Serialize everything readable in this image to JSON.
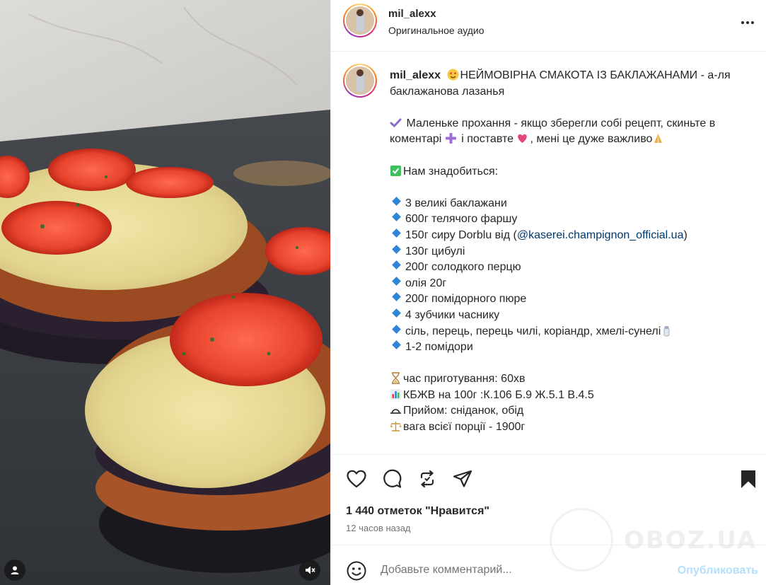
{
  "header": {
    "username": "mil_alexx",
    "audio": "Оригинальное аудио",
    "more_icon": "more-horizontal-icon"
  },
  "caption": {
    "username": "mil_alexx",
    "title": "НЕЙМОВІРНА СМАКОТА ІЗ БАКЛАЖАНАМИ - а-ля баклажанова лазанья",
    "request_part1": "Маленьке прохання - якщо зберегли собі рецепт, скиньте в коментарі",
    "request_part2": "і поставте",
    "request_part3": ", мені це дуже важливо",
    "need": "Нам знадобиться:",
    "ingredients": [
      "3 великі баклажани",
      "600г телячого фаршу",
      "150г сиру Dorblu від (",
      "130г цибулі",
      "200г солодкого перцю",
      "олія 20г",
      "200г помідорного пюре",
      "4 зубчики часнику",
      "сіль, перець, перець чилі, коріандр, хмелі-сунелі",
      "1-2 помідори"
    ],
    "mention": "@kaserei.champignon_official.ua",
    "mention_close": ")",
    "time": "час приготування: 60хв",
    "kbzhu": "КБЖВ на 100г :К.106 Б.9 Ж.5.1 В.4.5",
    "meal": "Прийом: сніданок, обід",
    "weight": "вага всієї порції - 1900г"
  },
  "actions": {
    "likes": "1 440 отметок \"Нравится\"",
    "time_ago": "12 часов назад"
  },
  "comment": {
    "placeholder": "Добавьте комментарий...",
    "post_label": "Опубликовать"
  },
  "watermark": {
    "text": "OBOZ.UA"
  },
  "colors": {
    "accent_link": "#00376b",
    "post_disabled": "#b2dffc",
    "diamond": "#2f86d6",
    "check": "#3fbf5f"
  }
}
